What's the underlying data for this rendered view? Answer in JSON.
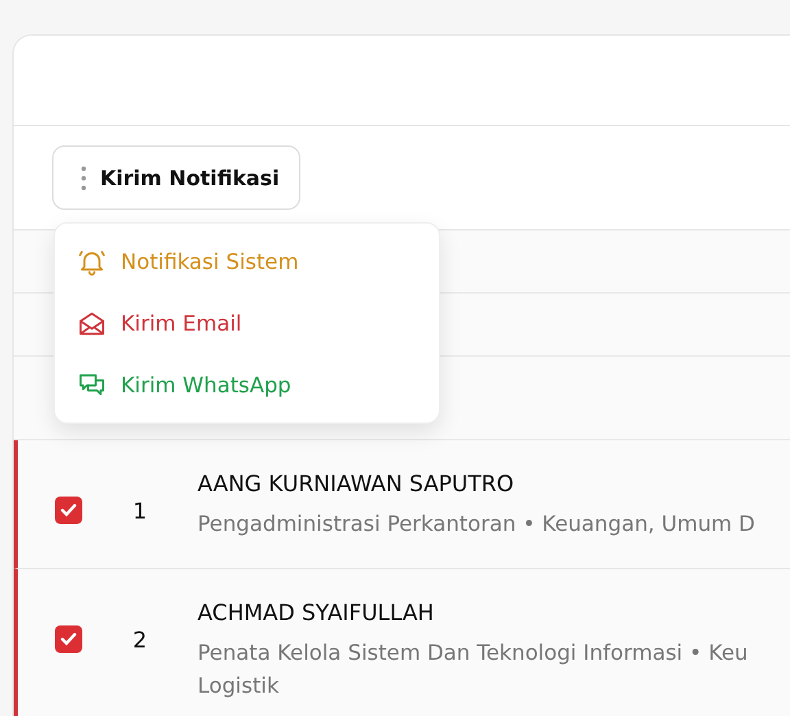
{
  "toolbar": {
    "button": {
      "label": "Kirim Notifikasi"
    }
  },
  "menu": {
    "open": true,
    "items": [
      {
        "kind": "bell",
        "label": "Notifikasi Sistem",
        "color": "#d4901c"
      },
      {
        "kind": "mail",
        "label": "Kirim Email",
        "color": "#d0333a"
      },
      {
        "kind": "chat",
        "label": "Kirim WhatsApp",
        "color": "#1fa14c"
      }
    ]
  },
  "rows": [
    {
      "checked": true,
      "number": "1",
      "name": "AANG KURNIAWAN SAPUTRO",
      "detail_lines": [
        "Pengadministrasi Perkantoran • Keuangan, Umum D"
      ]
    },
    {
      "checked": true,
      "number": "2",
      "name": "ACHMAD SYAIFULLAH",
      "detail_lines": [
        "Penata Kelola Sistem Dan Teknologi Informasi • Keu",
        "Logistik"
      ]
    }
  ]
}
